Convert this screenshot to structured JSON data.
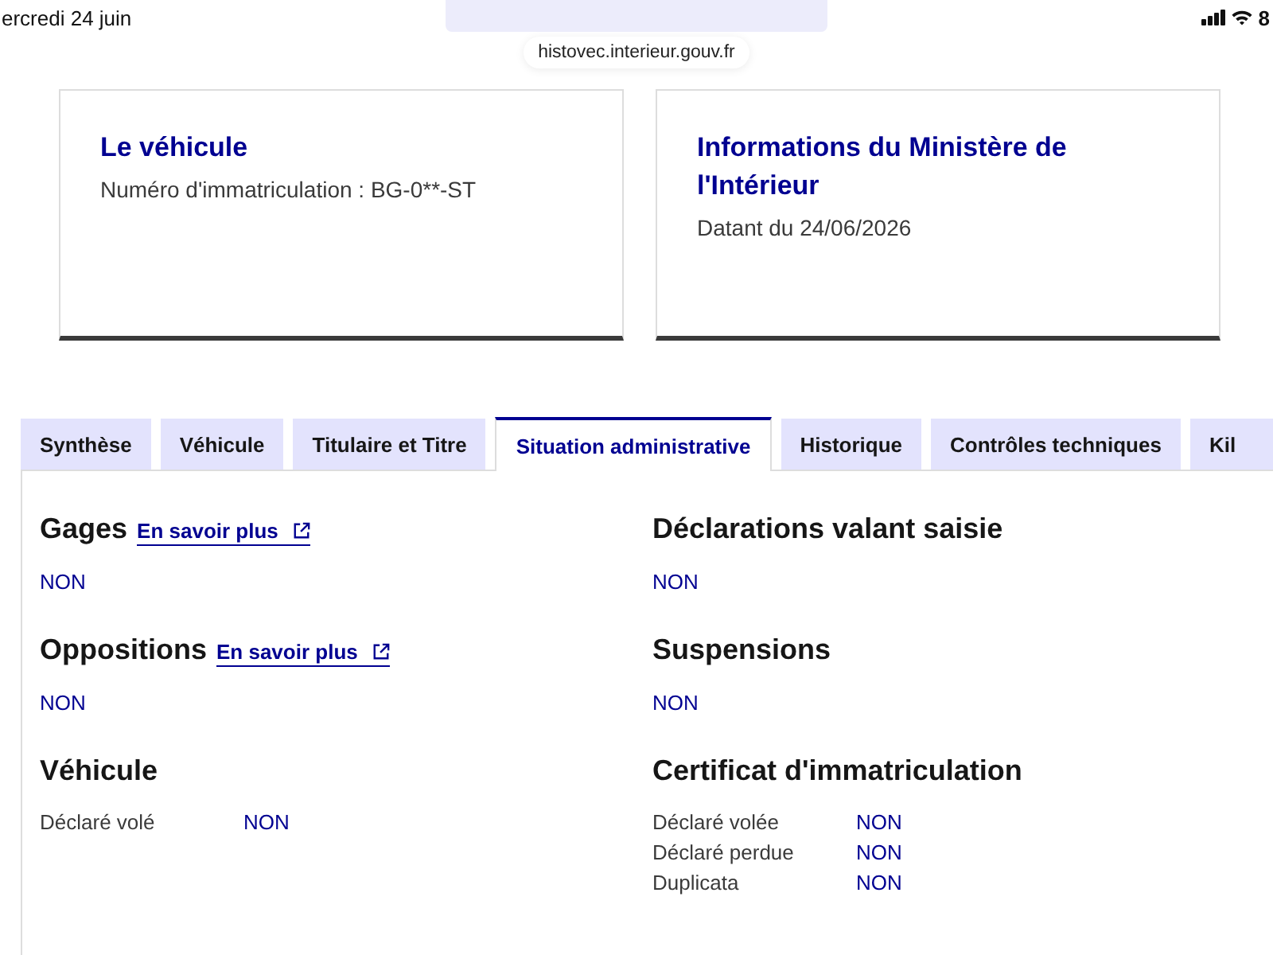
{
  "status_bar": {
    "time": "ercredi 24 juin",
    "battery": "8"
  },
  "address_bar": {
    "url": "histovec.interieur.gouv.fr"
  },
  "cards": [
    {
      "title": "Le véhicule",
      "text": "Numéro d'immatriculation : BG-0**-ST"
    },
    {
      "title": "Informations du Ministère de l'Intérieur",
      "text": "Datant du 24/06/2026"
    }
  ],
  "tabs": [
    {
      "label": "Synthèse",
      "selected": false
    },
    {
      "label": "Véhicule",
      "selected": false
    },
    {
      "label": "Titulaire et Titre",
      "selected": false
    },
    {
      "label": "Situation administrative",
      "selected": true
    },
    {
      "label": "Historique",
      "selected": false
    },
    {
      "label": "Contrôles techniques",
      "selected": false
    },
    {
      "label": "Kil",
      "selected": false
    }
  ],
  "panel": {
    "columns": [
      {
        "sections": [
          {
            "kind": "status",
            "title": "Gages",
            "link": "En savoir plus",
            "value": "NON"
          },
          {
            "kind": "status",
            "title": "Oppositions",
            "link": "En savoir plus",
            "value": "NON"
          },
          {
            "kind": "table",
            "title": "Véhicule",
            "rows": [
              {
                "label": "Déclaré volé",
                "value": "NON"
              }
            ]
          }
        ]
      },
      {
        "sections": [
          {
            "kind": "status",
            "title": "Déclarations valant saisie",
            "value": "NON"
          },
          {
            "kind": "status",
            "title": "Suspensions",
            "value": "NON"
          },
          {
            "kind": "table",
            "title": "Certificat d'immatriculation",
            "rows": [
              {
                "label": "Déclaré volée",
                "value": "NON"
              },
              {
                "label": "Déclaré perdue",
                "value": "NON"
              },
              {
                "label": "Duplicata",
                "value": "NON"
              }
            ]
          }
        ]
      }
    ]
  }
}
